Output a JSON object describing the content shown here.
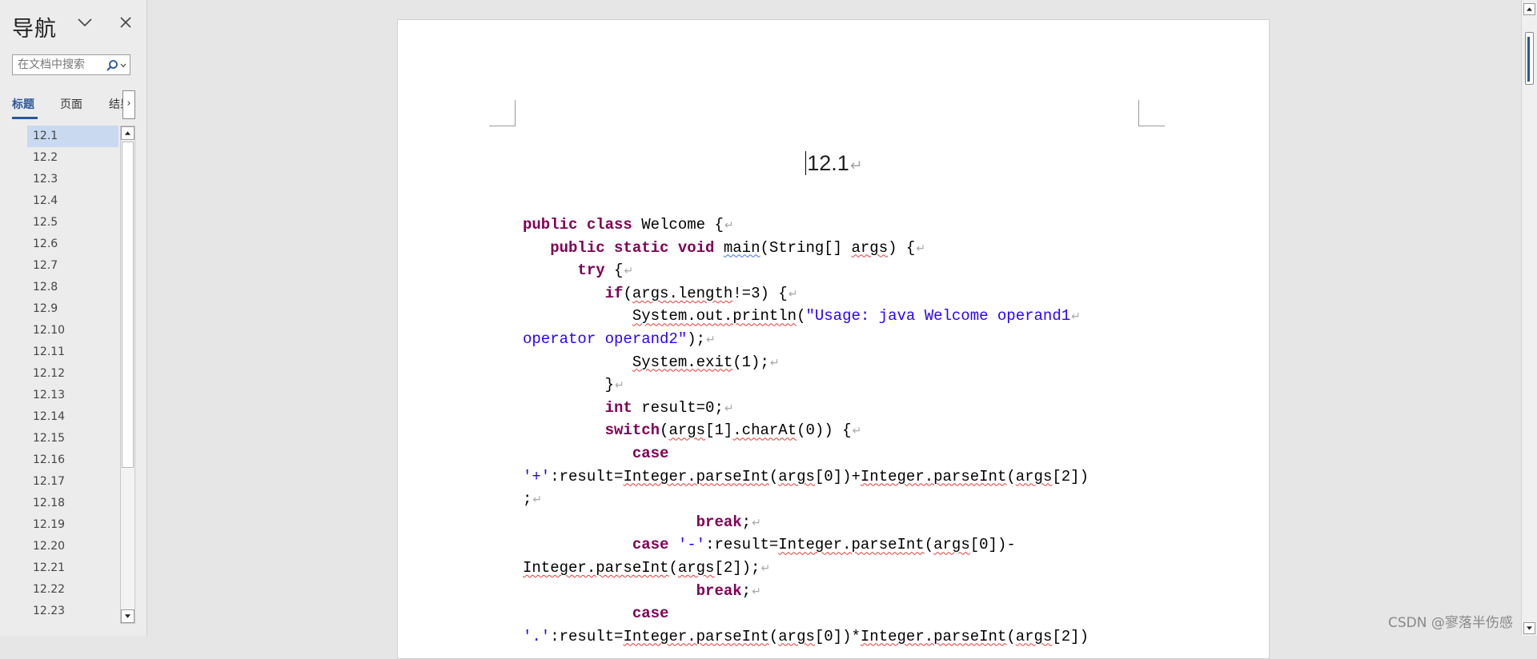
{
  "nav": {
    "title": "导航",
    "search": {
      "placeholder": "在文档中搜索",
      "value": ""
    },
    "tabs": [
      {
        "label": "标题",
        "active": true
      },
      {
        "label": "页面",
        "active": false
      },
      {
        "label": "结果",
        "active": false
      }
    ],
    "tab_scroll_glyph": "›",
    "icons": {
      "dropdown": "chevron-down-icon",
      "close": "close-icon",
      "search": "search-icon",
      "search_options": "caret-down-icon"
    },
    "headings": [
      {
        "label": "12.1",
        "selected": true
      },
      {
        "label": "12.2"
      },
      {
        "label": "12.3"
      },
      {
        "label": "12.4"
      },
      {
        "label": "12.5"
      },
      {
        "label": "12.6"
      },
      {
        "label": "12.7"
      },
      {
        "label": "12.8"
      },
      {
        "label": "12.9"
      },
      {
        "label": "12.10"
      },
      {
        "label": "12.11"
      },
      {
        "label": "12.12"
      },
      {
        "label": "12.13"
      },
      {
        "label": "12.14"
      },
      {
        "label": "12.15"
      },
      {
        "label": "12.16"
      },
      {
        "label": "12.17"
      },
      {
        "label": "12.18"
      },
      {
        "label": "12.19"
      },
      {
        "label": "12.20"
      },
      {
        "label": "12.21"
      },
      {
        "label": "12.22"
      },
      {
        "label": "12.23"
      }
    ]
  },
  "document": {
    "heading": "12.1",
    "paragraph_mark": "↵",
    "code_lines": [
      [
        {
          "t": "public class",
          "k": "kw"
        },
        {
          "t": " Welcome {"
        }
      ],
      [
        {
          "t": "   "
        },
        {
          "t": "public static void",
          "k": "kw"
        },
        {
          "t": " "
        },
        {
          "t": "main",
          "k": "sqb"
        },
        {
          "t": "(String[] "
        },
        {
          "t": "args",
          "k": "sq"
        },
        {
          "t": ") {"
        }
      ],
      [
        {
          "t": "      "
        },
        {
          "t": "try",
          "k": "kw"
        },
        {
          "t": " {"
        }
      ],
      [
        {
          "t": "         "
        },
        {
          "t": "if",
          "k": "kw"
        },
        {
          "t": "("
        },
        {
          "t": "args.length",
          "k": "sq"
        },
        {
          "t": "!=3) {"
        }
      ],
      [
        {
          "t": "            "
        },
        {
          "t": "System.out.println",
          "k": "sq"
        },
        {
          "t": "("
        },
        {
          "t": "\"Usage: java Welcome operand1",
          "k": "str"
        }
      ],
      [
        {
          "t": "operator operand2\"",
          "k": "str"
        },
        {
          "t": ");"
        }
      ],
      [
        {
          "t": "            "
        },
        {
          "t": "System.exit",
          "k": "sq"
        },
        {
          "t": "(1);"
        }
      ],
      [
        {
          "t": "         }"
        }
      ],
      [
        {
          "t": "         "
        },
        {
          "t": "int",
          "k": "kw"
        },
        {
          "t": " result=0;"
        }
      ],
      [
        {
          "t": "         "
        },
        {
          "t": "switch",
          "k": "kw"
        },
        {
          "t": "("
        },
        {
          "t": "args",
          "k": "sq"
        },
        {
          "t": "[1]"
        },
        {
          "t": ".charAt",
          "k": "sq"
        },
        {
          "t": "(0)) {"
        }
      ],
      [
        {
          "t": "            "
        },
        {
          "t": "case",
          "k": "kw"
        },
        {
          "t": "",
          "nomark": true
        }
      ],
      [
        {
          "t": "'+'",
          "k": "str"
        },
        {
          "t": ":result="
        },
        {
          "t": "Integer.parseInt",
          "k": "sq"
        },
        {
          "t": "("
        },
        {
          "t": "args",
          "k": "sq"
        },
        {
          "t": "[0])+"
        },
        {
          "t": "Integer.parseInt",
          "k": "sq"
        },
        {
          "t": "("
        },
        {
          "t": "args",
          "k": "sq"
        },
        {
          "t": "[2])",
          "nomark": true
        }
      ],
      [
        {
          "t": ";"
        }
      ],
      [
        {
          "t": "                   "
        },
        {
          "t": "break",
          "k": "kw"
        },
        {
          "t": ";"
        }
      ],
      [
        {
          "t": "            "
        },
        {
          "t": "case",
          "k": "kw"
        },
        {
          "t": " "
        },
        {
          "t": "'-'",
          "k": "str"
        },
        {
          "t": ":result="
        },
        {
          "t": "Integer.parseInt",
          "k": "sq"
        },
        {
          "t": "("
        },
        {
          "t": "args",
          "k": "sq"
        },
        {
          "t": "[0])-",
          "nomark": true
        }
      ],
      [
        {
          "t": "Integer.parseInt",
          "k": "sq"
        },
        {
          "t": "("
        },
        {
          "t": "args",
          "k": "sq"
        },
        {
          "t": "[2]);"
        }
      ],
      [
        {
          "t": "                   "
        },
        {
          "t": "break",
          "k": "kw"
        },
        {
          "t": ";"
        }
      ],
      [
        {
          "t": "            "
        },
        {
          "t": "case",
          "k": "kw"
        },
        {
          "t": "",
          "nomark": true
        }
      ],
      [
        {
          "t": "'.'",
          "k": "str"
        },
        {
          "t": ":result="
        },
        {
          "t": "Integer.parseInt",
          "k": "sq"
        },
        {
          "t": "("
        },
        {
          "t": "args",
          "k": "sq"
        },
        {
          "t": "[0])*"
        },
        {
          "t": "Integer.parseInt",
          "k": "sq"
        },
        {
          "t": "("
        },
        {
          "t": "args",
          "k": "sq"
        },
        {
          "t": "[2])",
          "nomark": true
        }
      ]
    ]
  },
  "watermark": "CSDN @寥落半伤感",
  "colors": {
    "accent": "#2b579a",
    "keyword": "#7f0055",
    "string": "#2a00ff",
    "spell_error": "#e23b3b",
    "grammar_error": "#3a6ee8",
    "selected_heading_bg": "#c9d9f0"
  }
}
